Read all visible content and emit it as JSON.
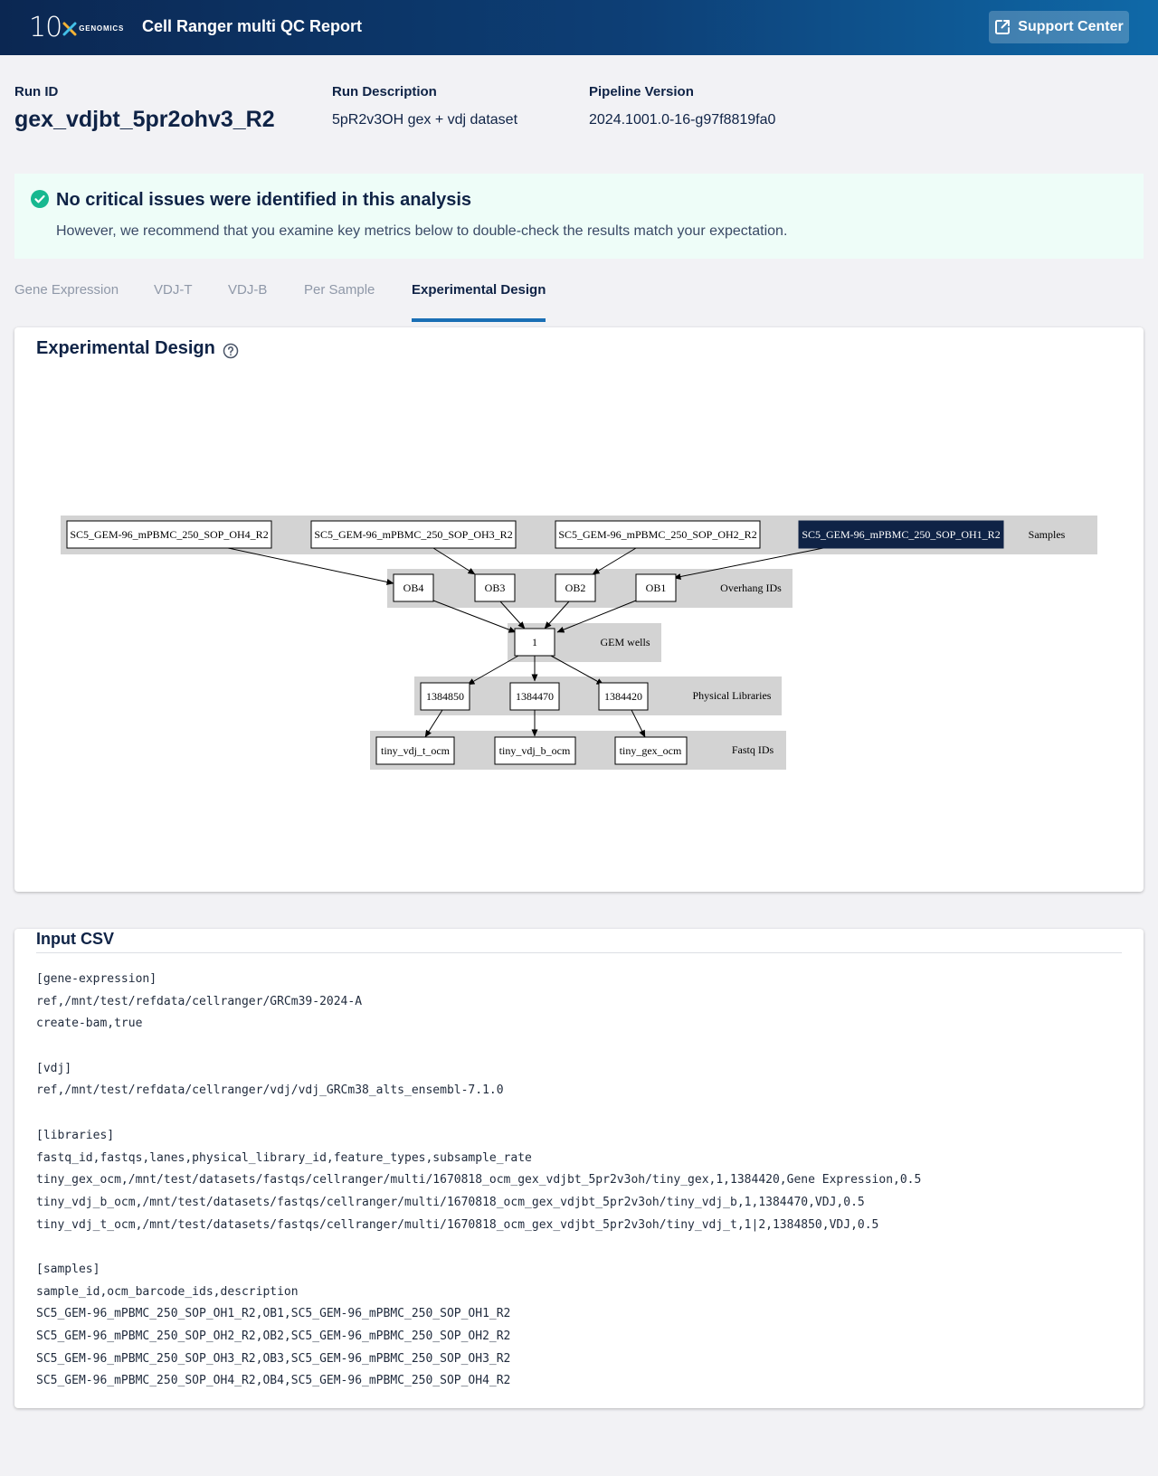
{
  "header": {
    "logo_text": "10",
    "logo_sub": "GENOMICS",
    "title": "Cell Ranger multi QC Report",
    "support_label": "Support Center"
  },
  "run": {
    "id_label": "Run ID",
    "id_value": "gex_vdjbt_5pr2ohv3_R2",
    "desc_label": "Run Description",
    "desc_value": "5pR2v3OH gex + vdj dataset",
    "version_label": "Pipeline Version",
    "version_value": "2024.1001.0-16-g97f8819fa0"
  },
  "alert": {
    "title": "No critical issues were identified in this analysis",
    "subtitle": "However, we recommend that you examine key metrics below to double-check the results match your expectation.",
    "color": "#17b890"
  },
  "tabs": [
    {
      "label": "Gene Expression"
    },
    {
      "label": "VDJ-T"
    },
    {
      "label": "VDJ-B"
    },
    {
      "label": "Per Sample"
    },
    {
      "label": "Experimental Design",
      "active": true
    }
  ],
  "design": {
    "title": "Experimental Design",
    "groups": {
      "samples": "Samples",
      "overhang": "Overhang IDs",
      "gem": "GEM wells",
      "physical": "Physical Libraries",
      "fastq": "Fastq IDs"
    },
    "nodes": {
      "s4": "SC5_GEM-96_mPBMC_250_SOP_OH4_R2",
      "s3": "SC5_GEM-96_mPBMC_250_SOP_OH3_R2",
      "s2": "SC5_GEM-96_mPBMC_250_SOP_OH2_R2",
      "s1": "SC5_GEM-96_mPBMC_250_SOP_OH1_R2",
      "ob4": "OB4",
      "ob3": "OB3",
      "ob2": "OB2",
      "ob1": "OB1",
      "gem1": "1",
      "lib1": "1384850",
      "lib2": "1384470",
      "lib3": "1384420",
      "fq1": "tiny_vdj_t_ocm",
      "fq2": "tiny_vdj_b_ocm",
      "fq3": "tiny_gex_ocm"
    },
    "highlight_color": "#0f2346"
  },
  "csv": {
    "title": "Input CSV",
    "lines": [
      "[gene-expression]",
      "ref,/mnt/test/refdata/cellranger/GRCm39-2024-A",
      "create-bam,true",
      "",
      "[vdj]",
      "ref,/mnt/test/refdata/cellranger/vdj/vdj_GRCm38_alts_ensembl-7.1.0",
      "",
      "[libraries]",
      "fastq_id,fastqs,lanes,physical_library_id,feature_types,subsample_rate",
      "tiny_gex_ocm,/mnt/test/datasets/fastqs/cellranger/multi/1670818_ocm_gex_vdjbt_5pr2v3oh/tiny_gex,1,1384420,Gene Expression,0.5",
      "tiny_vdj_b_ocm,/mnt/test/datasets/fastqs/cellranger/multi/1670818_ocm_gex_vdjbt_5pr2v3oh/tiny_vdj_b,1,1384470,VDJ,0.5",
      "tiny_vdj_t_ocm,/mnt/test/datasets/fastqs/cellranger/multi/1670818_ocm_gex_vdjbt_5pr2v3oh/tiny_vdj_t,1|2,1384850,VDJ,0.5",
      "",
      "[samples]",
      "sample_id,ocm_barcode_ids,description",
      "SC5_GEM-96_mPBMC_250_SOP_OH1_R2,OB1,SC5_GEM-96_mPBMC_250_SOP_OH1_R2",
      "SC5_GEM-96_mPBMC_250_SOP_OH2_R2,OB2,SC5_GEM-96_mPBMC_250_SOP_OH2_R2",
      "SC5_GEM-96_mPBMC_250_SOP_OH3_R2,OB3,SC5_GEM-96_mPBMC_250_SOP_OH3_R2",
      "SC5_GEM-96_mPBMC_250_SOP_OH4_R2,OB4,SC5_GEM-96_mPBMC_250_SOP_OH4_R2"
    ]
  },
  "icons": {
    "logo_mark": "x-mark-icon",
    "support": "external-link-icon",
    "alert": "check-circle-icon",
    "help": "question-circle-icon"
  }
}
